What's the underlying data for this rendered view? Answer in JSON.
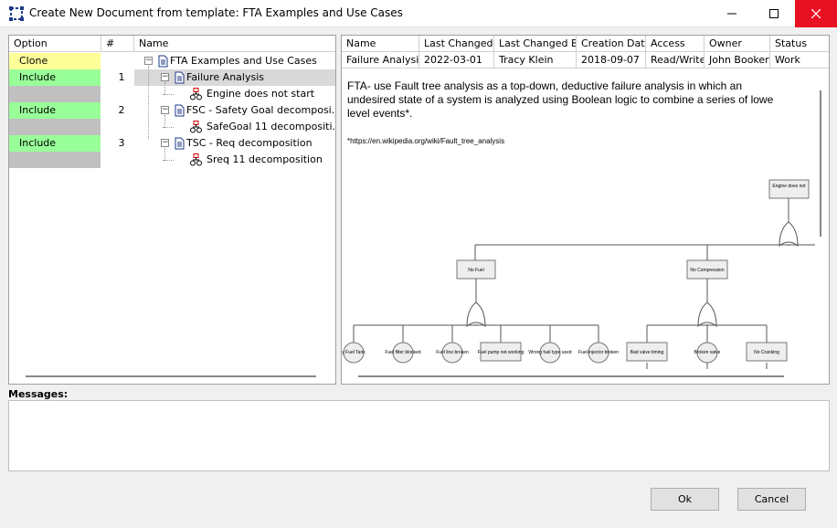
{
  "window": {
    "title": "Create New Document from template: FTA Examples and Use Cases",
    "accent_color": "#1e3a8a",
    "close_color": "#e81123"
  },
  "left_grid": {
    "headers": {
      "option": "Option",
      "num": "#",
      "name": "Name"
    },
    "rows": [
      {
        "option": "Clone",
        "option_color": "#ffff99",
        "num": "",
        "name": "FTA Examples and Use Cases",
        "icon": "document-icon",
        "level": 0
      },
      {
        "option": "Include",
        "option_color": "#99ff99",
        "num": "1",
        "name": "Failure Analysis",
        "icon": "document-icon",
        "level": 1,
        "selected": true
      },
      {
        "option": "",
        "option_color": "#c0c0c0",
        "num": "",
        "name": "Engine does not start",
        "icon": "fault-tree-icon",
        "level": 2
      },
      {
        "option": "Include",
        "option_color": "#99ff99",
        "num": "2",
        "name": "FSC - Safety Goal decomposi...",
        "icon": "document-icon",
        "level": 1
      },
      {
        "option": "",
        "option_color": "#c0c0c0",
        "num": "",
        "name": "SafeGoal 11 decompositi...",
        "icon": "fault-tree-icon",
        "level": 2
      },
      {
        "option": "Include",
        "option_color": "#99ff99",
        "num": "3",
        "name": "TSC - Req decomposition",
        "icon": "document-icon",
        "level": 1
      },
      {
        "option": "",
        "option_color": "#c0c0c0",
        "num": "",
        "name": "Sreq 11 decomposition",
        "icon": "fault-tree-icon",
        "level": 2
      }
    ]
  },
  "details": {
    "headers": [
      "Name",
      "Last Changed",
      "Last Changed By",
      "Creation Date",
      "Access",
      "Owner",
      "Status"
    ],
    "values": [
      "Failure Analysis",
      "2022-03-01",
      "Tracy Klein",
      "2018-09-07",
      "Read/Write",
      "John Booker",
      "Work"
    ]
  },
  "preview": {
    "description_lines": [
      "FTA- use Fault tree analysis as a top-down, deductive failure analysis in which an",
      "undesired state of a system is analyzed using Boolean logic to combine a series of lowe",
      "level events*."
    ],
    "footnote": "*https://en.wikipedia.org/wiki/Fault_tree_analysis",
    "diagram": {
      "top_event": "Engine does not start",
      "mid_events": [
        "No Fuel",
        "No Compression"
      ],
      "fuel_children": [
        "y Fuel Tank",
        "Fuel filter blocked",
        "Fuel line broken",
        "Fuel pump not working",
        "Wrong fuel type used",
        "Fuel injector broken"
      ],
      "compression_children": [
        "Bad valve timing",
        "Broken valve",
        "No Cranking"
      ]
    }
  },
  "messages": {
    "label": "Messages:"
  },
  "buttons": {
    "ok": "Ok",
    "cancel": "Cancel"
  }
}
